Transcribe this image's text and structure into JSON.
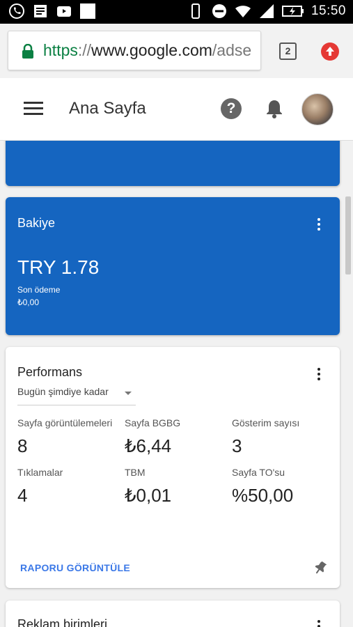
{
  "status_bar": {
    "time": "15:50",
    "icons": [
      "whatsapp-icon",
      "news-icon",
      "video-icon",
      "image-icon",
      "vibrate-icon",
      "dnd-icon",
      "wifi-icon",
      "signal-icon",
      "battery-charging-icon"
    ]
  },
  "browser": {
    "url_scheme": "https",
    "url_sep": "://",
    "url_host": "www.google.com",
    "url_path": "/adse",
    "tab_count": "2"
  },
  "header": {
    "title": "Ana Sayfa",
    "help_symbol": "?"
  },
  "balance_card": {
    "title": "Bakiye",
    "amount": "TRY 1.78",
    "last_payment_label": "Son ödeme",
    "last_payment_value": "₺0,00"
  },
  "performance_card": {
    "title": "Performans",
    "range": "Bugün şimdiye kadar",
    "metrics": [
      {
        "label": "Sayfa görüntülemeleri",
        "value": "8"
      },
      {
        "label": "Sayfa BGBG",
        "value": "₺6,44"
      },
      {
        "label": "Gösterim sayısı",
        "value": "3"
      },
      {
        "label": "Tıklamalar",
        "value": "4"
      },
      {
        "label": "TBM",
        "value": "₺0,01"
      },
      {
        "label": "Sayfa TO'su",
        "value": "%50,00"
      }
    ],
    "report_link": "RAPORU GÖRÜNTÜLE"
  },
  "ad_units_card": {
    "title": "Reklam birimleri"
  },
  "colors": {
    "card_blue": "#1565c0",
    "link_blue": "#3b78e7",
    "secure_green": "#0b8043",
    "update_red": "#e53935"
  }
}
